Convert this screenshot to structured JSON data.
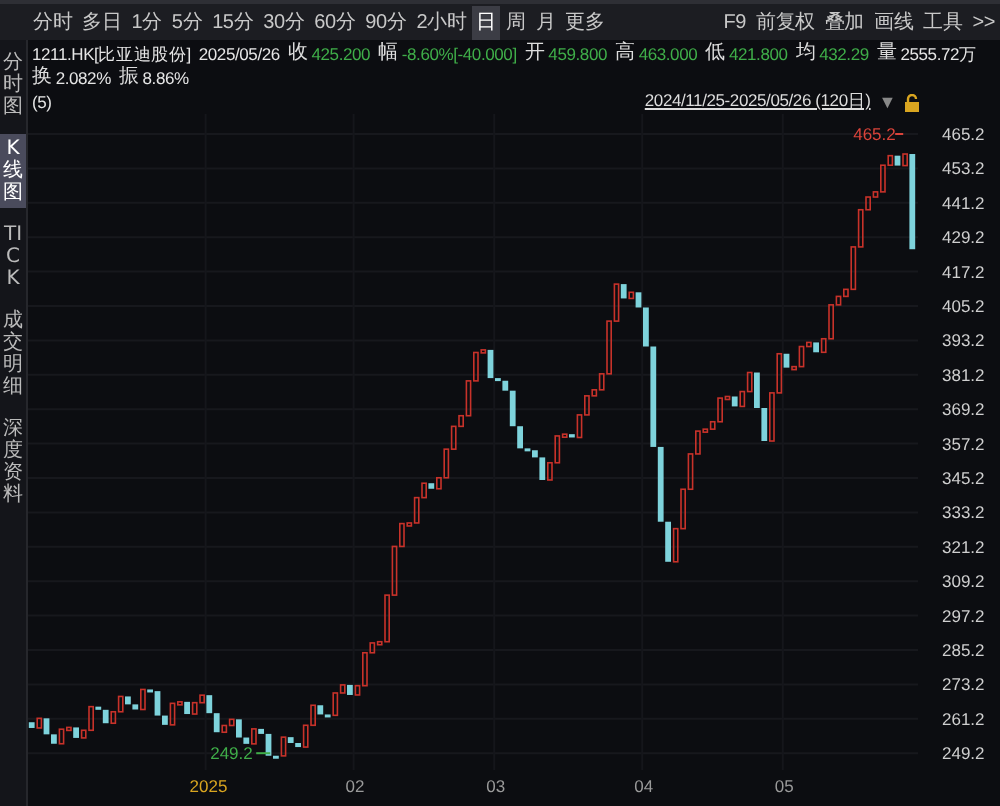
{
  "toolbar": {
    "tabs": [
      {
        "label": "分时",
        "selected": false
      },
      {
        "label": "多日",
        "selected": false
      },
      {
        "label": "1分",
        "selected": false
      },
      {
        "label": "5分",
        "selected": false
      },
      {
        "label": "15分",
        "selected": false
      },
      {
        "label": "30分",
        "selected": false
      },
      {
        "label": "60分",
        "selected": false
      },
      {
        "label": "90分",
        "selected": false
      },
      {
        "label": "2小时",
        "selected": false
      },
      {
        "label": "日",
        "selected": true
      },
      {
        "label": "周",
        "selected": false
      },
      {
        "label": "月",
        "selected": false
      },
      {
        "label": "更多",
        "selected": false
      }
    ],
    "tools": [
      "F9",
      "前复权",
      "叠加",
      "画线",
      "工具",
      ">>"
    ]
  },
  "sidebar": {
    "items": [
      {
        "label": "分时图",
        "selected": false
      },
      {
        "label": "K线图",
        "selected": true
      },
      {
        "label": "TICK",
        "selected": false
      },
      {
        "label": "成交明细",
        "selected": false
      },
      {
        "label": "深度资料",
        "selected": false
      }
    ]
  },
  "quote": {
    "symbol": "1211.HK[比亚迪股份]",
    "date": "2025/05/26",
    "fields": [
      {
        "label": "收",
        "value": "425.200",
        "color": "#3fae49"
      },
      {
        "label": "幅",
        "value": "-8.60%[-40.000]",
        "color": "#3fae49"
      },
      {
        "label": "开",
        "value": "459.800",
        "color": "#3fae49"
      },
      {
        "label": "高",
        "value": "463.000",
        "color": "#3fae49"
      },
      {
        "label": "低",
        "value": "421.800",
        "color": "#3fae49"
      },
      {
        "label": "均",
        "value": "432.29",
        "color": "#3fae49"
      },
      {
        "label": "量",
        "value": "2555.72万",
        "color": "#e6e6e6"
      },
      {
        "label": "换",
        "value": "2.082%",
        "color": "#e6e6e6"
      },
      {
        "label": "振",
        "value": "8.86%",
        "color": "#e6e6e6"
      }
    ]
  },
  "chart": {
    "period_count": "(5)",
    "range": "2024/11/25-2025/05/26 (120日)",
    "range_dropdown": "▼",
    "yticks": [
      "465.2",
      "453.2",
      "441.2",
      "429.2",
      "417.2",
      "405.2",
      "393.2",
      "381.2",
      "369.2",
      "357.2",
      "345.2",
      "333.2",
      "321.2",
      "309.2",
      "297.2",
      "285.2",
      "273.2",
      "261.2",
      "249.2"
    ],
    "xlabels": [
      {
        "label": "2025",
        "kind": "year"
      },
      {
        "label": "02",
        "kind": "month"
      },
      {
        "label": "03",
        "kind": "month"
      },
      {
        "label": "04",
        "kind": "month"
      },
      {
        "label": "05",
        "kind": "month"
      }
    ],
    "high_label": "465.2",
    "low_label": "249.2"
  }
}
